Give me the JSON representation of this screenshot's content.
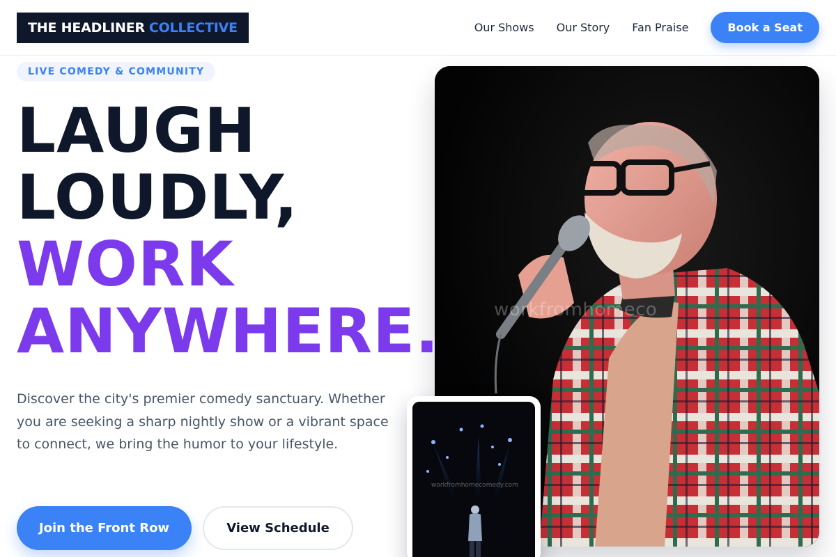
{
  "brand": {
    "part1": "THE HEADLINER",
    "part2": "COLLECTIVE"
  },
  "nav": {
    "items": [
      "Our Shows",
      "Our Story",
      "Fan Praise"
    ],
    "cta": "Book a Seat"
  },
  "hero": {
    "badge": "LIVE COMEDY & COMMUNITY",
    "headline": [
      "LAUGH",
      "LOUDLY,",
      "WORK",
      "ANYWHERE."
    ],
    "description": "Discover the city's premier comedy sanctuary. Whether you are seeking a sharp nightly show or a vibrant space to connect, we bring the humor to your lifestyle.",
    "primary_button": "Join the Front Row",
    "secondary_button": "View Schedule"
  },
  "media": {
    "main_watermark": "workfromhomeco",
    "card_watermark": "workfromhomecomedy.com"
  },
  "colors": {
    "accent": "#3b82f6",
    "purple": "#7c3aed",
    "dark": "#0f172a",
    "body_text": "#475569"
  }
}
